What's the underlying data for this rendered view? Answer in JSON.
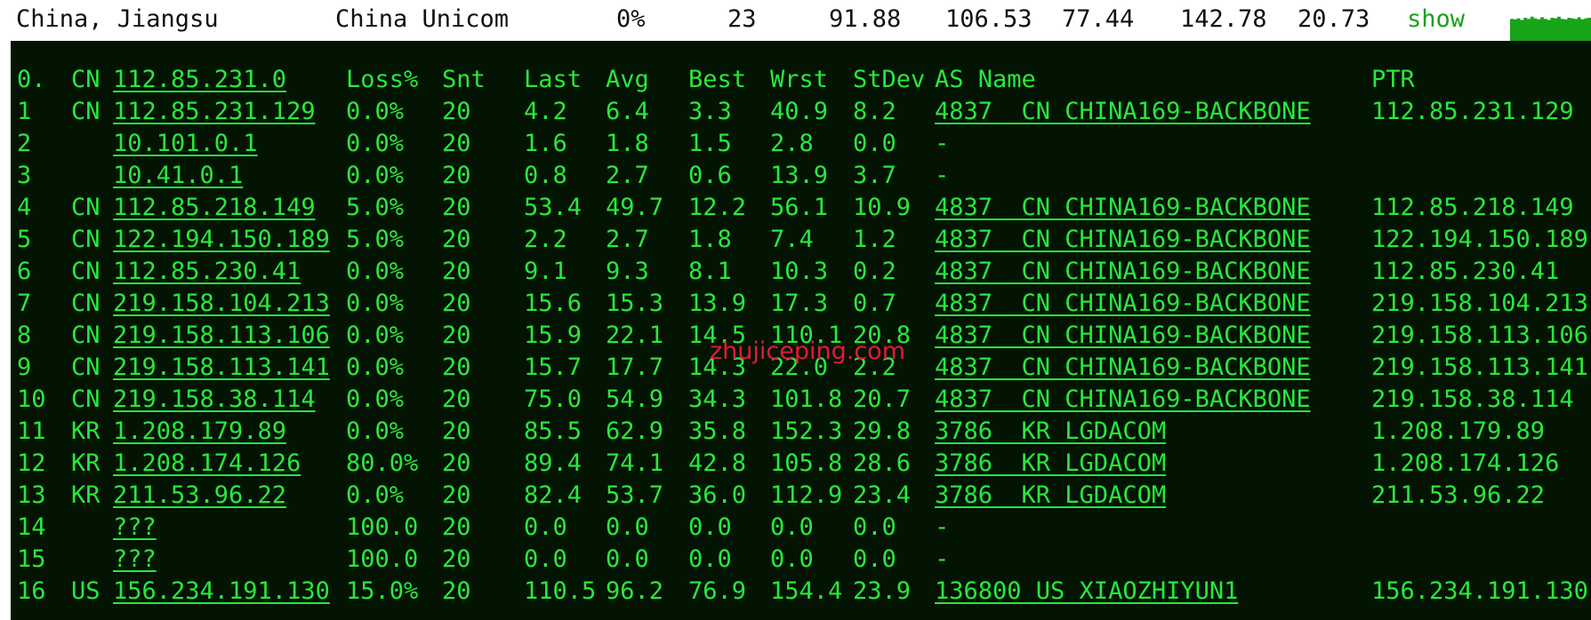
{
  "summary": {
    "location": "China, Jiangsu",
    "isp": "China Unicom",
    "loss": "0%",
    "snt": "23",
    "last": "91.88",
    "avg": "106.53",
    "best": "77.44",
    "wrst": "142.78",
    "stdev": "20.73",
    "show_label": "show"
  },
  "sparkline": {
    "color": "#19a319",
    "levels": [
      0.4,
      0.35,
      0.45,
      0.3,
      0.5,
      0.4,
      0.6,
      0.45,
      0.35,
      0.55,
      0.4,
      0.3,
      0.5,
      0.45,
      0.6,
      0.4,
      0.35,
      0.5,
      0.45,
      0.4,
      0.55,
      0.35,
      0.45,
      0.5
    ]
  },
  "table": {
    "headers": {
      "hop": "0.",
      "cc": "CN",
      "ip": "112.85.231.0",
      "loss": "Loss%",
      "snt": "Snt",
      "last": "Last",
      "avg": "Avg",
      "best": "Best",
      "wrst": "Wrst",
      "stdev": "StDev",
      "as": "AS Name",
      "ptr": "PTR"
    },
    "rows": [
      {
        "hop": "1",
        "cc": "CN",
        "ip": "112.85.231.129",
        "loss": "0.0%",
        "snt": "20",
        "last": "4.2",
        "avg": "6.4",
        "best": "3.3",
        "wrst": "40.9",
        "stdev": "8.2",
        "as": "4837  CN CHINA169-BACKBONE",
        "ptr": "112.85.231.129"
      },
      {
        "hop": "2",
        "cc": "",
        "ip": "10.101.0.1",
        "loss": "0.0%",
        "snt": "20",
        "last": "1.6",
        "avg": "1.8",
        "best": "1.5",
        "wrst": "2.8",
        "stdev": "0.0",
        "as": "-",
        "ptr": ""
      },
      {
        "hop": "3",
        "cc": "",
        "ip": "10.41.0.1",
        "loss": "0.0%",
        "snt": "20",
        "last": "0.8",
        "avg": "2.7",
        "best": "0.6",
        "wrst": "13.9",
        "stdev": "3.7",
        "as": "-",
        "ptr": ""
      },
      {
        "hop": "4",
        "cc": "CN",
        "ip": "112.85.218.149",
        "loss": "5.0%",
        "snt": "20",
        "last": "53.4",
        "avg": "49.7",
        "best": "12.2",
        "wrst": "56.1",
        "stdev": "10.9",
        "as": "4837  CN CHINA169-BACKBONE",
        "ptr": "112.85.218.149"
      },
      {
        "hop": "5",
        "cc": "CN",
        "ip": "122.194.150.189",
        "loss": "5.0%",
        "snt": "20",
        "last": "2.2",
        "avg": "2.7",
        "best": "1.8",
        "wrst": "7.4",
        "stdev": "1.2",
        "as": "4837  CN CHINA169-BACKBONE",
        "ptr": "122.194.150.189"
      },
      {
        "hop": "6",
        "cc": "CN",
        "ip": "112.85.230.41",
        "loss": "0.0%",
        "snt": "20",
        "last": "9.1",
        "avg": "9.3",
        "best": "8.1",
        "wrst": "10.3",
        "stdev": "0.2",
        "as": "4837  CN CHINA169-BACKBONE",
        "ptr": "112.85.230.41"
      },
      {
        "hop": "7",
        "cc": "CN",
        "ip": "219.158.104.213",
        "loss": "0.0%",
        "snt": "20",
        "last": "15.6",
        "avg": "15.3",
        "best": "13.9",
        "wrst": "17.3",
        "stdev": "0.7",
        "as": "4837  CN CHINA169-BACKBONE",
        "ptr": "219.158.104.213"
      },
      {
        "hop": "8",
        "cc": "CN",
        "ip": "219.158.113.106",
        "loss": "0.0%",
        "snt": "20",
        "last": "15.9",
        "avg": "22.1",
        "best": "14.5",
        "wrst": "110.1",
        "stdev": "20.8",
        "as": "4837  CN CHINA169-BACKBONE",
        "ptr": "219.158.113.106"
      },
      {
        "hop": "9",
        "cc": "CN",
        "ip": "219.158.113.141",
        "loss": "0.0%",
        "snt": "20",
        "last": "15.7",
        "avg": "17.7",
        "best": "14.3",
        "wrst": "22.0",
        "stdev": "2.2",
        "as": "4837  CN CHINA169-BACKBONE",
        "ptr": "219.158.113.141"
      },
      {
        "hop": "10",
        "cc": "CN",
        "ip": "219.158.38.114",
        "loss": "0.0%",
        "snt": "20",
        "last": "75.0",
        "avg": "54.9",
        "best": "34.3",
        "wrst": "101.8",
        "stdev": "20.7",
        "as": "4837  CN CHINA169-BACKBONE",
        "ptr": "219.158.38.114"
      },
      {
        "hop": "11",
        "cc": "KR",
        "ip": "1.208.179.89",
        "loss": "0.0%",
        "snt": "20",
        "last": "85.5",
        "avg": "62.9",
        "best": "35.8",
        "wrst": "152.3",
        "stdev": "29.8",
        "as": "3786  KR LGDACOM",
        "ptr": "1.208.179.89"
      },
      {
        "hop": "12",
        "cc": "KR",
        "ip": "1.208.174.126",
        "loss": "80.0%",
        "snt": "20",
        "last": "89.4",
        "avg": "74.1",
        "best": "42.8",
        "wrst": "105.8",
        "stdev": "28.6",
        "as": "3786  KR LGDACOM",
        "ptr": "1.208.174.126"
      },
      {
        "hop": "13",
        "cc": "KR",
        "ip": "211.53.96.22",
        "loss": "0.0%",
        "snt": "20",
        "last": "82.4",
        "avg": "53.7",
        "best": "36.0",
        "wrst": "112.9",
        "stdev": "23.4",
        "as": "3786  KR LGDACOM",
        "ptr": "211.53.96.22"
      },
      {
        "hop": "14",
        "cc": "",
        "ip": "???",
        "loss": "100.0",
        "snt": "20",
        "last": "0.0",
        "avg": "0.0",
        "best": "0.0",
        "wrst": "0.0",
        "stdev": "0.0",
        "as": "-",
        "ptr": ""
      },
      {
        "hop": "15",
        "cc": "",
        "ip": "???",
        "loss": "100.0",
        "snt": "20",
        "last": "0.0",
        "avg": "0.0",
        "best": "0.0",
        "wrst": "0.0",
        "stdev": "0.0",
        "as": "-",
        "ptr": ""
      },
      {
        "hop": "16",
        "cc": "US",
        "ip": "156.234.191.130",
        "loss": "15.0%",
        "snt": "20",
        "last": "110.5",
        "avg": "96.2",
        "best": "76.9",
        "wrst": "154.4",
        "stdev": "23.9",
        "as": "136800 US XIAOZHIYUN1",
        "ptr": "156.234.191.130"
      }
    ]
  },
  "watermark": "zhujiceping.com"
}
